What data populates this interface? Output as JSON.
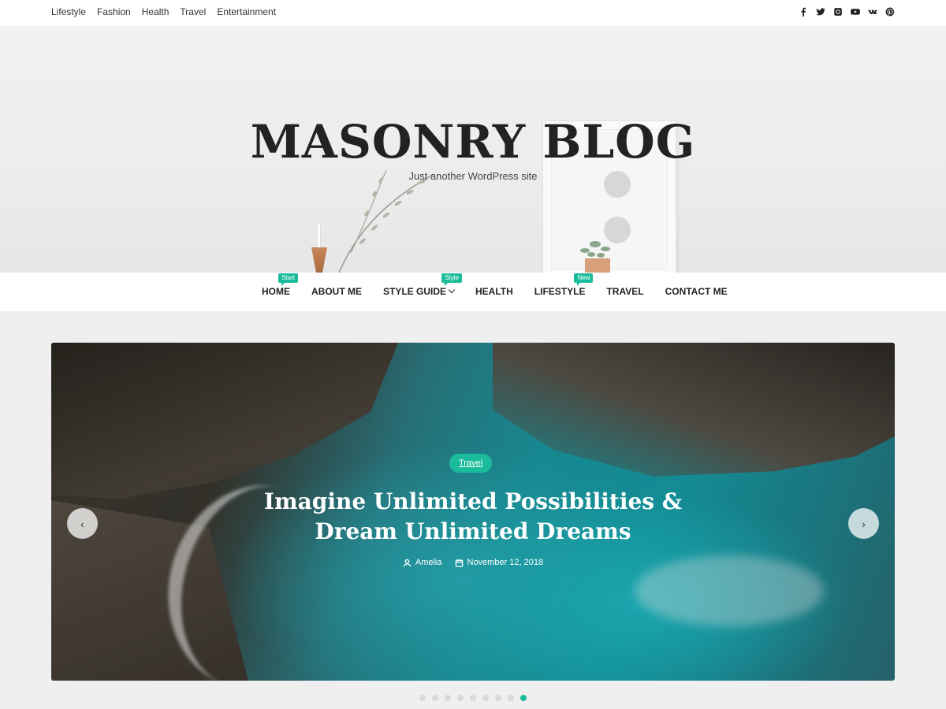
{
  "topbar": {
    "links": [
      "Lifestyle",
      "Fashion",
      "Health",
      "Travel",
      "Entertainment"
    ],
    "social_icons": [
      "facebook-icon",
      "twitter-icon",
      "instagram-icon",
      "youtube-icon",
      "vk-icon",
      "pinterest-icon"
    ]
  },
  "header": {
    "title": "MASONRY BLOG",
    "tagline": "Just another WordPress site"
  },
  "mainnav": {
    "items": [
      {
        "label": "HOME",
        "badge": "Start"
      },
      {
        "label": "ABOUT ME",
        "badge": ""
      },
      {
        "label": "STYLE GUIDE",
        "badge": "Style",
        "dropdown": true
      },
      {
        "label": "HEALTH",
        "badge": ""
      },
      {
        "label": "LIFESTYLE",
        "badge": "New"
      },
      {
        "label": "TRAVEL",
        "badge": ""
      },
      {
        "label": "CONTACT ME",
        "badge": ""
      }
    ]
  },
  "slider": {
    "category": "Travel",
    "title_line1": "Imagine Unlimited Possibilities &",
    "title_line2": "Dream Unlimited Dreams",
    "author": "Amelia",
    "date": "November 12, 2018",
    "prev_icon": "‹",
    "next_icon": "›",
    "dots_total": 9,
    "active_dot": 9
  },
  "colors": {
    "accent": "#1bbc9b",
    "text": "#222222"
  }
}
